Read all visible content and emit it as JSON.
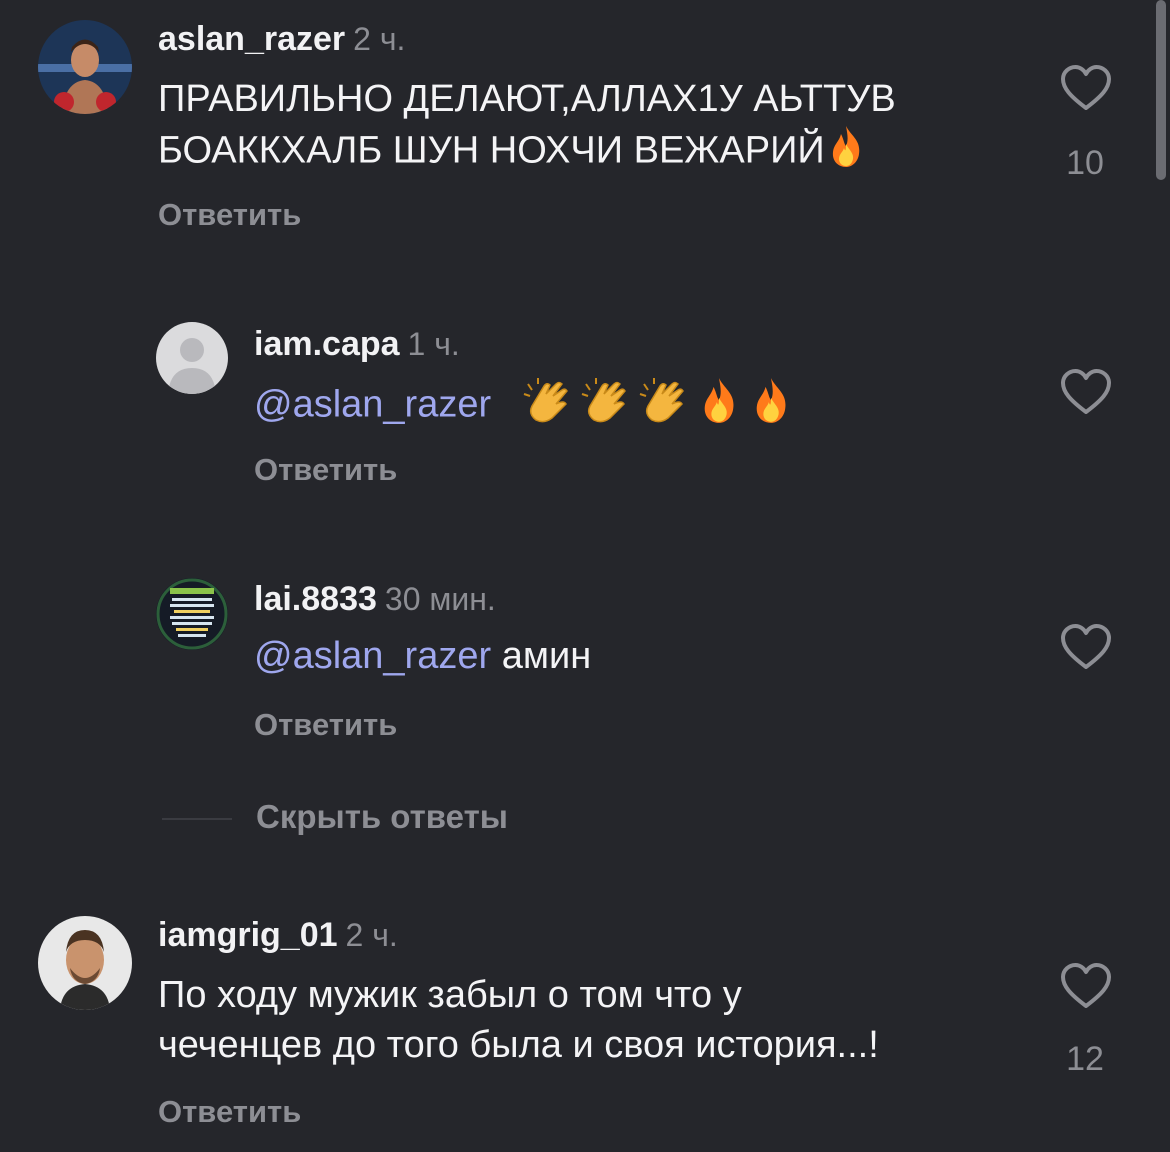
{
  "comments": [
    {
      "username": "aslan_razer",
      "time": "2 ч.",
      "text_line1": "ПРАВИЛЬНО ДЕЛАЮТ,АЛЛАХ1У АЬТТУВ",
      "text_line2": "БОАККХАЛБ ШУН НОХЧИ ВЕЖАРИЙ",
      "emojis": [
        "fire-emoji"
      ],
      "reply_label": "Ответить",
      "like_count": "10",
      "avatar": "boxer-photo"
    },
    {
      "username": "iam.capa",
      "time": "1 ч.",
      "mention": "@aslan_razer",
      "text": "",
      "emojis": [
        "clap-emoji",
        "clap-emoji",
        "clap-emoji",
        "fire-emoji",
        "fire-emoji"
      ],
      "reply_label": "Ответить",
      "avatar": "default-avatar"
    },
    {
      "username": "lai.8833",
      "time": "30 мин.",
      "mention": "@aslan_razer",
      "text": "амин",
      "reply_label": "Ответить",
      "avatar": "text-poster"
    },
    {
      "username": "iamgrig_01",
      "time": "2 ч.",
      "text_line1": "По ходу мужик забыл о том что у",
      "text_line2": "чеченцев до того была и своя история...!",
      "reply_label": "Ответить",
      "like_count": "12",
      "avatar": "man-portrait"
    }
  ],
  "hide_replies_label": "Скрыть ответы",
  "colors": {
    "background": "#25262b",
    "mention": "#9fa7ee",
    "muted": "#8d8e94"
  }
}
